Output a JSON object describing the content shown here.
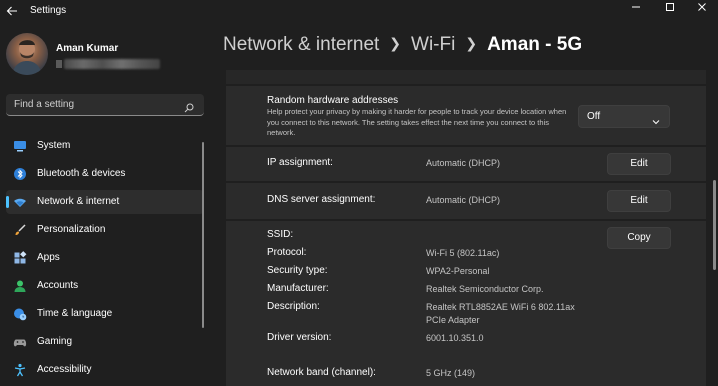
{
  "app": {
    "title": "Settings"
  },
  "profile": {
    "name": "Aman Kumar"
  },
  "search": {
    "placeholder": "Find a setting"
  },
  "sidebar": {
    "items": [
      {
        "label": "System",
        "icon": "monitor-icon"
      },
      {
        "label": "Bluetooth & devices",
        "icon": "bluetooth-icon"
      },
      {
        "label": "Network & internet",
        "icon": "wifi-icon",
        "active": true
      },
      {
        "label": "Personalization",
        "icon": "brush-icon"
      },
      {
        "label": "Apps",
        "icon": "apps-icon"
      },
      {
        "label": "Accounts",
        "icon": "person-icon"
      },
      {
        "label": "Time & language",
        "icon": "globe-clock-icon"
      },
      {
        "label": "Gaming",
        "icon": "gamepad-icon"
      },
      {
        "label": "Accessibility",
        "icon": "accessibility-icon"
      }
    ]
  },
  "breadcrumb": {
    "part1": "Network & internet",
    "part2": "Wi-Fi",
    "current": "Aman - 5G"
  },
  "random_hw": {
    "title": "Random hardware addresses",
    "description": "Help protect your privacy by making it harder for people to track your device location when you connect to this network. The setting takes effect the next time you connect to this network.",
    "value": "Off"
  },
  "ip": {
    "label": "IP assignment:",
    "value": "Automatic (DHCP)",
    "button": "Edit"
  },
  "dns": {
    "label": "DNS server assignment:",
    "value": "Automatic (DHCP)",
    "button": "Edit"
  },
  "props": {
    "copy_button": "Copy",
    "rows": [
      {
        "label": "SSID:",
        "value": ""
      },
      {
        "label": "Protocol:",
        "value": "Wi-Fi 5 (802.11ac)"
      },
      {
        "label": "Security type:",
        "value": "WPA2-Personal"
      },
      {
        "label": "Manufacturer:",
        "value": "Realtek Semiconductor Corp."
      },
      {
        "label": "Description:",
        "value": "Realtek RTL8852AE WiFi 6 802.11ax",
        "value2": "PCIe Adapter"
      },
      {
        "label": "Driver version:",
        "value": "6001.10.351.0"
      },
      {
        "label": "Network band (channel):",
        "value": "5 GHz (149)"
      }
    ]
  },
  "colors": {
    "accent": "#4cc2ff",
    "background": "#1f1f1f",
    "card": "#2b2b2b"
  }
}
